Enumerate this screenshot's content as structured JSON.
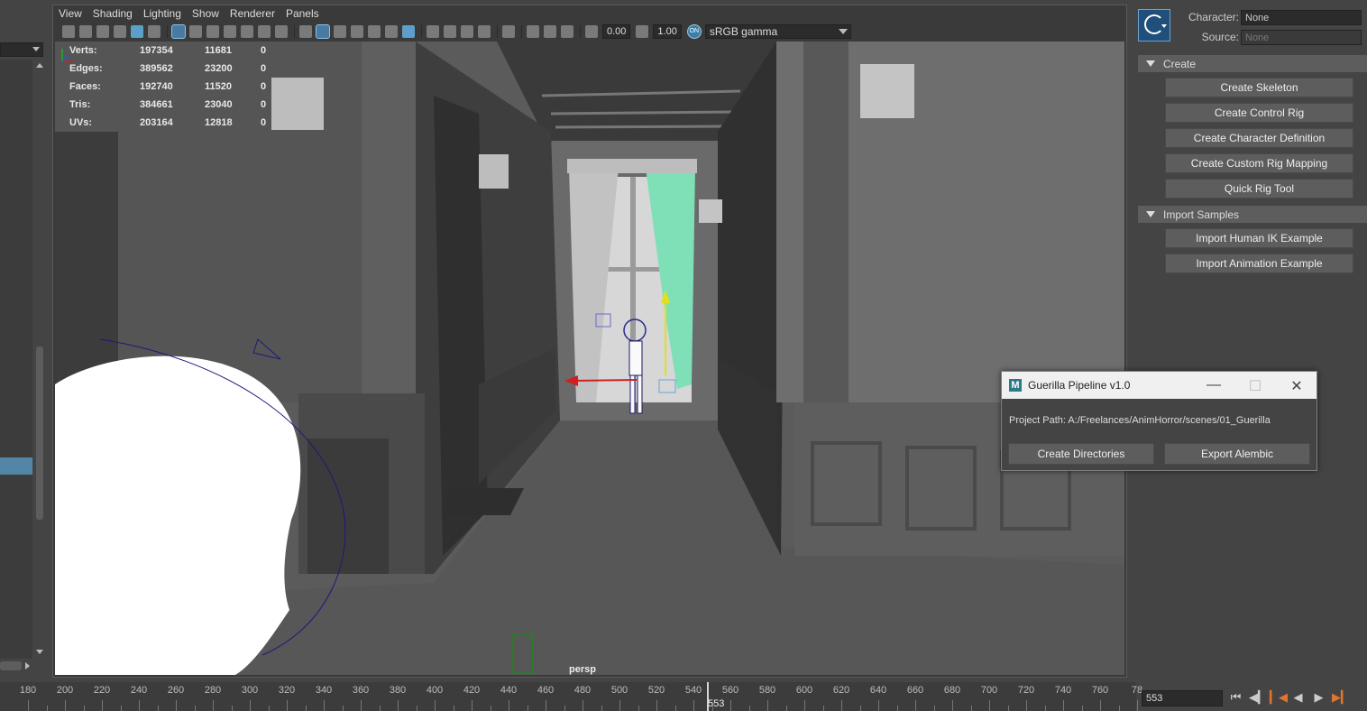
{
  "viewport": {
    "menu": [
      "View",
      "Shading",
      "Lighting",
      "Show",
      "Renderer",
      "Panels"
    ],
    "exposure": "0.00",
    "gamma": "1.00",
    "colorspace": "sRGB gamma",
    "camera": "persp",
    "stats": [
      {
        "label": "Verts:",
        "total": "197354",
        "selected": "11681",
        "extra": "0"
      },
      {
        "label": "Edges:",
        "total": "389562",
        "selected": "23200",
        "extra": "0"
      },
      {
        "label": "Faces:",
        "total": "192740",
        "selected": "11520",
        "extra": "0"
      },
      {
        "label": "Tris:",
        "total": "384661",
        "selected": "23040",
        "extra": "0"
      },
      {
        "label": "UVs:",
        "total": "203164",
        "selected": "12818",
        "extra": "0"
      }
    ]
  },
  "hik": {
    "character_label": "Character:",
    "character_value": "None",
    "source_label": "Source:",
    "source_value": "None",
    "sections": [
      {
        "title": "Create",
        "buttons": [
          "Create Skeleton",
          "Create Control Rig",
          "Create Character Definition",
          "Create Custom Rig Mapping",
          "Quick Rig Tool"
        ]
      },
      {
        "title": "Import Samples",
        "buttons": [
          "Import Human IK Example",
          "Import Animation Example"
        ]
      }
    ]
  },
  "guerilla": {
    "icon_letter": "M",
    "title": "Guerilla Pipeline v1.0",
    "project_path": "Project Path: A:/Freelances/AnimHorror/scenes/01_Guerilla",
    "create_dirs": "Create Directories",
    "export_alembic": "Export Alembic"
  },
  "timeline": {
    "ticks": [
      "180",
      "200",
      "220",
      "240",
      "260",
      "280",
      "300",
      "320",
      "340",
      "360",
      "380",
      "400",
      "420",
      "440",
      "460",
      "480",
      "500",
      "520",
      "540",
      "560",
      "580",
      "600",
      "620",
      "640",
      "660",
      "680",
      "700",
      "720",
      "740",
      "760",
      "78"
    ],
    "current_frame": "553",
    "frame_field": "553"
  }
}
